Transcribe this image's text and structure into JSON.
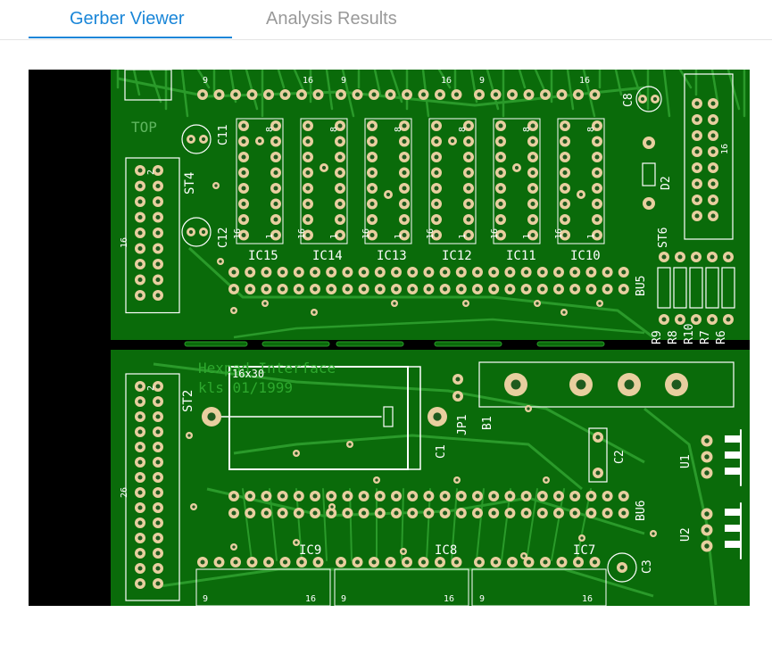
{
  "tabs": [
    {
      "label": "Gerber Viewer",
      "active": true
    },
    {
      "label": "Analysis Results",
      "active": false
    }
  ],
  "viewer": {
    "colors": {
      "board": "#0a6b0a",
      "trace": "#2a9a2a",
      "pad": "#e8cf9f",
      "hole": "#1e5a1e",
      "silk": "#ffffff",
      "background": "#000000"
    },
    "labels": {
      "side": "TOP",
      "title_line1": "Hexpad Interface",
      "title_line2": "kls 01/1999",
      "crystal": "16x30",
      "ic_labels": [
        "IC15",
        "IC14",
        "IC13",
        "IC12",
        "IC11",
        "IC10",
        "IC9",
        "IC8",
        "IC7"
      ],
      "connectors": [
        "ST4",
        "ST2",
        "ST6",
        "BU5",
        "BU6",
        "JP1",
        "B1"
      ],
      "caps": [
        "C11",
        "C12",
        "C8",
        "C1",
        "C2",
        "C3"
      ],
      "resistors": [
        "R9",
        "R8",
        "R10",
        "R7",
        "R6"
      ],
      "regulators": [
        "U1",
        "U2"
      ],
      "diode": "D2",
      "pin_marks": {
        "pin1": "1",
        "pin2": "2",
        "pin8": "8",
        "pin9": "9",
        "pin16": "16",
        "pin26": "26"
      }
    }
  }
}
